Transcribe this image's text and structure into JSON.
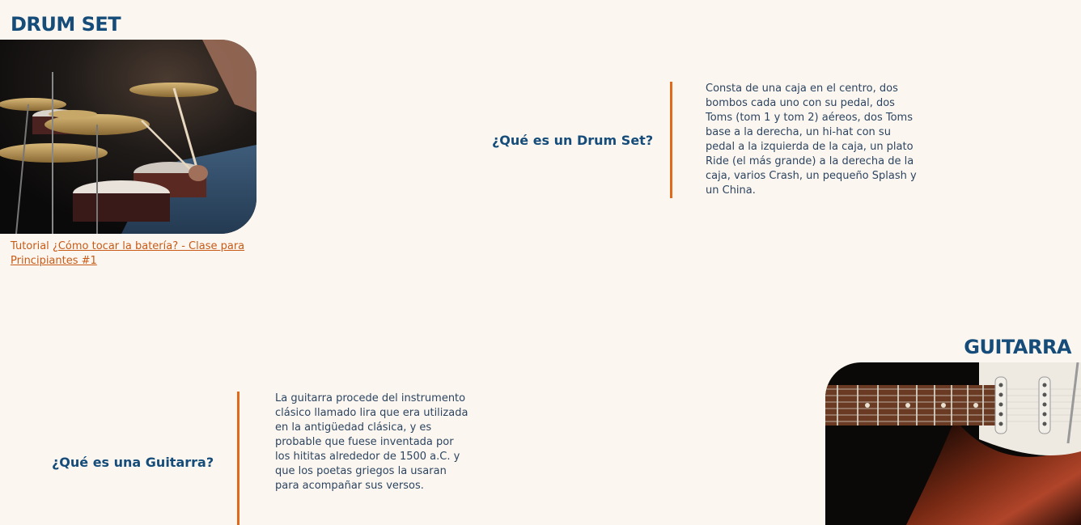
{
  "drums": {
    "title": "DRUM SET",
    "image_alt": "drummer playing drum kit",
    "tutorial_prefix": "Tutorial ",
    "tutorial_link": "¿Cómo tocar la batería? - Clase para Principiantes #1",
    "question": "¿Qué es un Drum Set?",
    "description": "Consta de una caja en el centro, dos bombos cada uno con su pedal, dos Toms (tom 1 y tom 2) aéreos, dos Toms base a la derecha, un hi-hat con su pedal a la izquierda de la caja, un plato Ride (el más grande) a la derecha de la caja, varios Crash, un pequeño Splash y un China."
  },
  "guitar": {
    "title": "GUITARRA",
    "image_alt": "electric guitar body and fretboard",
    "question": "¿Qué es una Guitarra?",
    "description": "La guitarra procede del instrumento clásico llamado lira que era utilizada en la antigüedad clásica, y es probable que fuese inventada por los hititas alrededor de 1500 a.C. y que los poetas griegos la usaran para acompañar sus versos."
  },
  "colors": {
    "background": "#fbf7f0",
    "heading": "#154c79",
    "accent": "#e06a1b",
    "link": "#c85a17",
    "body_text": "#2d4460"
  }
}
